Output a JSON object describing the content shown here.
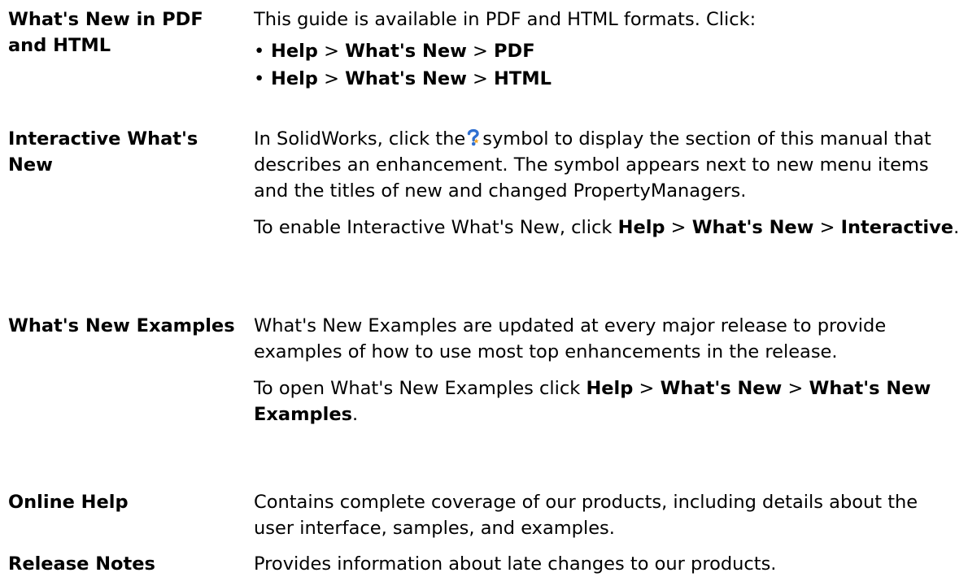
{
  "rows": [
    {
      "term": "What's New in PDF and HTML",
      "intro": "This guide is available in PDF and HTML formats. Click:",
      "bullets": [
        {
          "a": "Help",
          "sep1": " > ",
          "b": "What's New",
          "sep2": " > ",
          "c": "PDF"
        },
        {
          "a": "Help",
          "sep1": " > ",
          "b": "What's New",
          "sep2": " > ",
          "c": "HTML"
        }
      ]
    },
    {
      "term": "Interactive What's New",
      "p1_before": "In SolidWorks, click the",
      "p1_after": "symbol to display the section of this manual that describes an enhancement. The symbol appears next to new menu items and the titles of new and changed PropertyManagers.",
      "p2_before": "To enable Interactive What's New, click ",
      "p2_b1": "Help",
      "p2_sep1": " > ",
      "p2_b2": "What's New",
      "p2_sep2": " > ",
      "p2_b3": "Interactive",
      "p2_end": "."
    },
    {
      "term": "What's New Examples",
      "p1": "What's New Examples are updated at every major release to provide examples of how to use most top enhancements in the release.",
      "p2_before": "To open What's New Examples click ",
      "p2_b1": "Help",
      "p2_sep1": " > ",
      "p2_b2": "What's New",
      "p2_sep2": " > ",
      "p2_b3": "What's New Examples",
      "p2_end": "."
    },
    {
      "term": "Online Help",
      "p1": "Contains complete coverage of our products, including details about the user interface, samples, and examples."
    },
    {
      "term": "Release Notes",
      "p1": "Provides information about late changes to our products."
    }
  ],
  "icons": {
    "help_symbol": "whats-new-help-icon"
  },
  "colors": {
    "icon_blue": "#2f6fd0",
    "icon_orange": "#f5a623"
  }
}
